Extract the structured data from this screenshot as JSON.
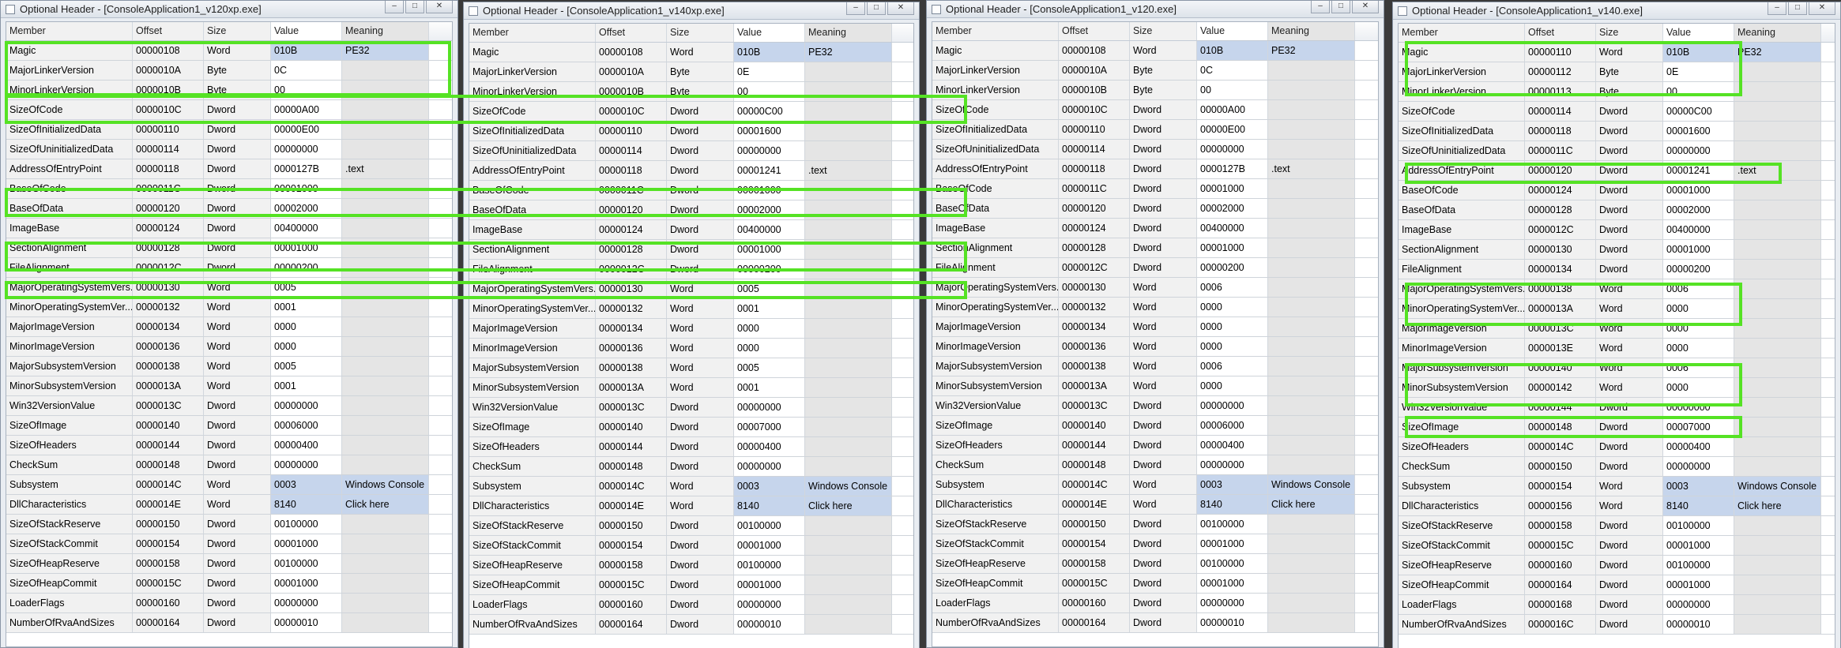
{
  "columns": {
    "member": "Member",
    "offset": "Offset",
    "size": "Size",
    "value": "Value",
    "meaning": "Meaning"
  },
  "members": [
    "Magic",
    "MajorLinkerVersion",
    "MinorLinkerVersion",
    "SizeOfCode",
    "SizeOfInitializedData",
    "SizeOfUninitializedData",
    "AddressOfEntryPoint",
    "BaseOfCode",
    "BaseOfData",
    "ImageBase",
    "SectionAlignment",
    "FileAlignment",
    "MajorOperatingSystemVers...",
    "MinorOperatingSystemVer...",
    "MajorImageVersion",
    "MinorImageVersion",
    "MajorSubsystemVersion",
    "MinorSubsystemVersion",
    "Win32VersionValue",
    "SizeOfImage",
    "SizeOfHeaders",
    "CheckSum",
    "Subsystem",
    "DllCharacteristics",
    "SizeOfStackReserve",
    "SizeOfStackCommit",
    "SizeOfHeapReserve",
    "SizeOfHeapCommit",
    "LoaderFlags",
    "NumberOfRvaAndSizes"
  ],
  "sizes": [
    "Word",
    "Byte",
    "Byte",
    "Dword",
    "Dword",
    "Dword",
    "Dword",
    "Dword",
    "Dword",
    "Dword",
    "Dword",
    "Dword",
    "Word",
    "Word",
    "Word",
    "Word",
    "Word",
    "Word",
    "Dword",
    "Dword",
    "Dword",
    "Dword",
    "Word",
    "Word",
    "Dword",
    "Dword",
    "Dword",
    "Dword",
    "Dword",
    "Dword"
  ],
  "highlight_color": "#55e224",
  "windows": [
    {
      "title": "Optional Header - [ConsoleApplication1_v120xp.exe]",
      "offsets": [
        "00000108",
        "0000010A",
        "0000010B",
        "0000010C",
        "00000110",
        "00000114",
        "00000118",
        "0000011C",
        "00000120",
        "00000124",
        "00000128",
        "0000012C",
        "00000130",
        "00000132",
        "00000134",
        "00000136",
        "00000138",
        "0000013A",
        "0000013C",
        "00000140",
        "00000144",
        "00000148",
        "0000014C",
        "0000014E",
        "00000150",
        "00000154",
        "00000158",
        "0000015C",
        "00000160",
        "00000164"
      ],
      "values": [
        "010B",
        "0C",
        "00",
        "00000A00",
        "00000E00",
        "00000000",
        "0000127B",
        "00001000",
        "00002000",
        "00400000",
        "00001000",
        "00000200",
        "0005",
        "0001",
        "0000",
        "0000",
        "0005",
        "0001",
        "00000000",
        "00006000",
        "00000400",
        "00000000",
        "0003",
        "8140",
        "00100000",
        "00001000",
        "00100000",
        "00001000",
        "00000000",
        "00000010"
      ],
      "meanings": [
        "PE32",
        "",
        "",
        "",
        "",
        "",
        ".text",
        "",
        "",
        "",
        "",
        "",
        "",
        "",
        "",
        "",
        "",
        "",
        "",
        "",
        "",
        "",
        "Windows Console",
        "Click here",
        "",
        "",
        "",
        "",
        "",
        ""
      ]
    },
    {
      "title": "Optional Header - [ConsoleApplication1_v140xp.exe]",
      "offsets": [
        "00000108",
        "0000010A",
        "0000010B",
        "0000010C",
        "00000110",
        "00000114",
        "00000118",
        "0000011C",
        "00000120",
        "00000124",
        "00000128",
        "0000012C",
        "00000130",
        "00000132",
        "00000134",
        "00000136",
        "00000138",
        "0000013A",
        "0000013C",
        "00000140",
        "00000144",
        "00000148",
        "0000014C",
        "0000014E",
        "00000150",
        "00000154",
        "00000158",
        "0000015C",
        "00000160",
        "00000164"
      ],
      "values": [
        "010B",
        "0E",
        "00",
        "00000C00",
        "00001600",
        "00000000",
        "00001241",
        "00001000",
        "00002000",
        "00400000",
        "00001000",
        "00000200",
        "0005",
        "0001",
        "0000",
        "0000",
        "0005",
        "0001",
        "00000000",
        "00007000",
        "00000400",
        "00000000",
        "0003",
        "8140",
        "00100000",
        "00001000",
        "00100000",
        "00001000",
        "00000000",
        "00000010"
      ],
      "meanings": [
        "PE32",
        "",
        "",
        "",
        "",
        "",
        ".text",
        "",
        "",
        "",
        "",
        "",
        "",
        "",
        "",
        "",
        "",
        "",
        "",
        "",
        "",
        "",
        "Windows Console",
        "Click here",
        "",
        "",
        "",
        "",
        "",
        ""
      ]
    },
    {
      "title": "Optional Header - [ConsoleApplication1_v120.exe]",
      "offsets": [
        "00000108",
        "0000010A",
        "0000010B",
        "0000010C",
        "00000110",
        "00000114",
        "00000118",
        "0000011C",
        "00000120",
        "00000124",
        "00000128",
        "0000012C",
        "00000130",
        "00000132",
        "00000134",
        "00000136",
        "00000138",
        "0000013A",
        "0000013C",
        "00000140",
        "00000144",
        "00000148",
        "0000014C",
        "0000014E",
        "00000150",
        "00000154",
        "00000158",
        "0000015C",
        "00000160",
        "00000164"
      ],
      "values": [
        "010B",
        "0C",
        "00",
        "00000A00",
        "00000E00",
        "00000000",
        "0000127B",
        "00001000",
        "00002000",
        "00400000",
        "00001000",
        "00000200",
        "0006",
        "0000",
        "0000",
        "0000",
        "0006",
        "0000",
        "00000000",
        "00006000",
        "00000400",
        "00000000",
        "0003",
        "8140",
        "00100000",
        "00001000",
        "00100000",
        "00001000",
        "00000000",
        "00000010"
      ],
      "meanings": [
        "PE32",
        "",
        "",
        "",
        "",
        "",
        ".text",
        "",
        "",
        "",
        "",
        "",
        "",
        "",
        "",
        "",
        "",
        "",
        "",
        "",
        "",
        "",
        "Windows Console",
        "Click here",
        "",
        "",
        "",
        "",
        "",
        ""
      ]
    },
    {
      "title": "Optional Header - [ConsoleApplication1_v140.exe]",
      "offsets": [
        "00000110",
        "00000112",
        "00000113",
        "00000114",
        "00000118",
        "0000011C",
        "00000120",
        "00000124",
        "00000128",
        "0000012C",
        "00000130",
        "00000134",
        "00000138",
        "0000013A",
        "0000013C",
        "0000013E",
        "00000140",
        "00000142",
        "00000144",
        "00000148",
        "0000014C",
        "00000150",
        "00000154",
        "00000156",
        "00000158",
        "0000015C",
        "00000160",
        "00000164",
        "00000168",
        "0000016C"
      ],
      "values": [
        "010B",
        "0E",
        "00",
        "00000C00",
        "00001600",
        "00000000",
        "00001241",
        "00001000",
        "00002000",
        "00400000",
        "00001000",
        "00000200",
        "0006",
        "0000",
        "0000",
        "0000",
        "0006",
        "0000",
        "00000000",
        "00007000",
        "00000400",
        "00000000",
        "0003",
        "8140",
        "00100000",
        "00001000",
        "00100000",
        "00001000",
        "00000000",
        "00000010"
      ],
      "meanings": [
        "PE32",
        "",
        "",
        "",
        "",
        "",
        ".text",
        "",
        "",
        "",
        "",
        "",
        "",
        "",
        "",
        "",
        "",
        "",
        "",
        "",
        "",
        "",
        "Windows Console",
        "Click here",
        "",
        "",
        "",
        "",
        "",
        ""
      ]
    }
  ]
}
